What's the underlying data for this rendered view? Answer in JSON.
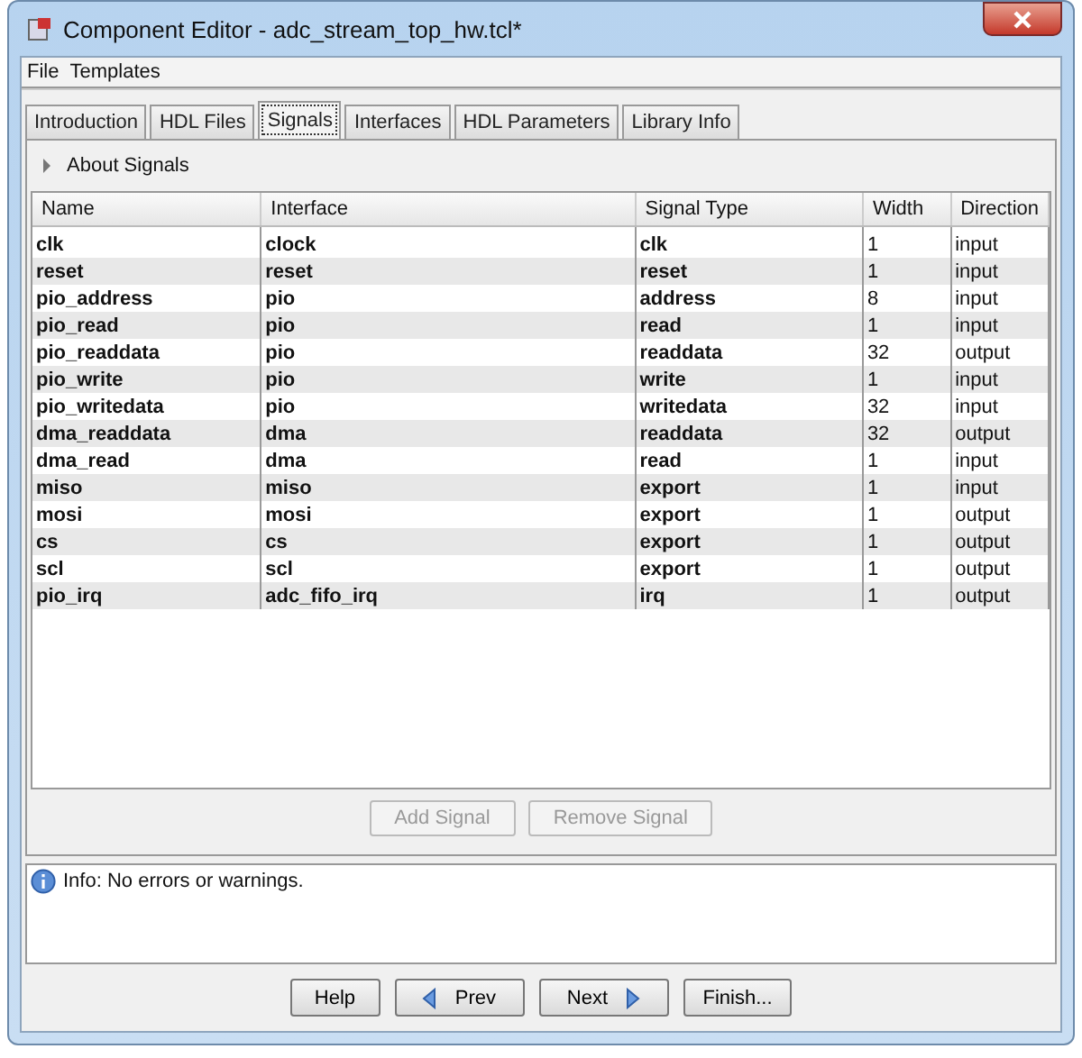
{
  "window": {
    "title": "Component Editor - adc_stream_top_hw.tcl*"
  },
  "menu": [
    "File",
    "Templates"
  ],
  "tabs": [
    {
      "label": "Introduction",
      "selected": false
    },
    {
      "label": "HDL Files",
      "selected": false
    },
    {
      "label": "Signals",
      "selected": true
    },
    {
      "label": "Interfaces",
      "selected": false
    },
    {
      "label": "HDL Parameters",
      "selected": false
    },
    {
      "label": "Library Info",
      "selected": false
    }
  ],
  "section": {
    "label": "About Signals",
    "expanded": false
  },
  "table": {
    "columns": [
      "Name",
      "Interface",
      "Signal Type",
      "Width",
      "Direction"
    ],
    "rows": [
      [
        "clk",
        "clock",
        "clk",
        "1",
        "input"
      ],
      [
        "reset",
        "reset",
        "reset",
        "1",
        "input"
      ],
      [
        "pio_address",
        "pio",
        "address",
        "8",
        "input"
      ],
      [
        "pio_read",
        "pio",
        "read",
        "1",
        "input"
      ],
      [
        "pio_readdata",
        "pio",
        "readdata",
        "32",
        "output"
      ],
      [
        "pio_write",
        "pio",
        "write",
        "1",
        "input"
      ],
      [
        "pio_writedata",
        "pio",
        "writedata",
        "32",
        "input"
      ],
      [
        "dma_readdata",
        "dma",
        "readdata",
        "32",
        "output"
      ],
      [
        "dma_read",
        "dma",
        "read",
        "1",
        "input"
      ],
      [
        "miso",
        "miso",
        "export",
        "1",
        "input"
      ],
      [
        "mosi",
        "mosi",
        "export",
        "1",
        "output"
      ],
      [
        "cs",
        "cs",
        "export",
        "1",
        "output"
      ],
      [
        "scl",
        "scl",
        "export",
        "1",
        "output"
      ],
      [
        "pio_irq",
        "adc_fifo_irq",
        "irq",
        "1",
        "output"
      ]
    ]
  },
  "table_buttons": [
    {
      "label": "Add Signal",
      "disabled": true
    },
    {
      "label": "Remove Signal",
      "disabled": true
    }
  ],
  "messages": [
    {
      "kind": "info",
      "text": "Info: No errors or warnings."
    }
  ],
  "footer_buttons": [
    {
      "label": "Help",
      "kind": "plain"
    },
    {
      "label": "Prev",
      "kind": "prev"
    },
    {
      "label": "Next",
      "kind": "next"
    },
    {
      "label": "Finish...",
      "kind": "plain"
    }
  ]
}
